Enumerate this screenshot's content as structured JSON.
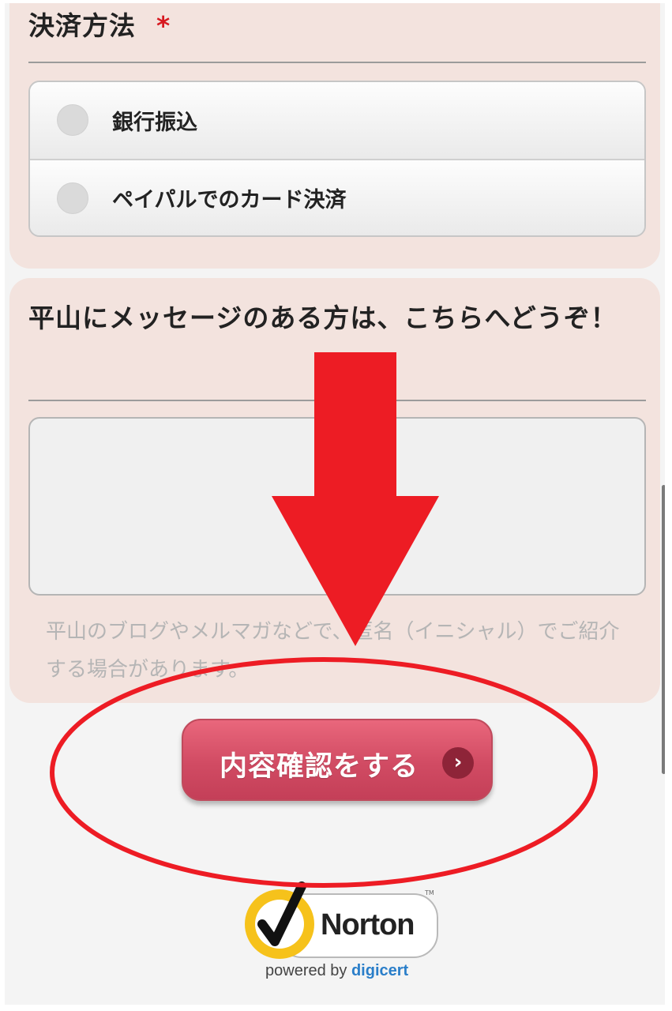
{
  "payment": {
    "title": "決済方法",
    "required_mark": "*",
    "options": [
      {
        "label": "銀行振込"
      },
      {
        "label": "ペイパルでのカード決済"
      }
    ]
  },
  "message": {
    "title": "平山にメッセージのある方は、こちらへどうぞ！",
    "textarea_value": "",
    "helper": "平山のブログやメルマガなどで、匿名（イニシャル）でご紹介する場合があります。"
  },
  "submit": {
    "label": "内容確認をする",
    "chevron": "›"
  },
  "badge": {
    "brand": "Norton",
    "tm": "TM",
    "powered_prefix": "powered by ",
    "powered_brand": "digicert"
  },
  "colors": {
    "card_bg": "#f3e3de",
    "required": "#d71920",
    "button": "#d14b63",
    "annotation": "#ed1c24"
  }
}
